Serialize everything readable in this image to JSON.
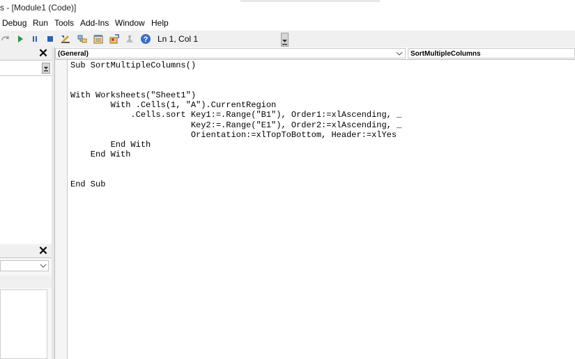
{
  "window": {
    "title": "s - [Module1 (Code)]"
  },
  "menu": [
    "Debug",
    "Run",
    "Tools",
    "Add-Ins",
    "Window",
    "Help"
  ],
  "toolbar": {
    "icons": [
      "redo-icon",
      "run-icon",
      "break-icon",
      "reset-icon",
      "design-mode-icon",
      "project-explorer-icon",
      "properties-window-icon",
      "object-browser-icon",
      "toolbox-icon",
      "help-icon"
    ],
    "position": "Ln 1, Col 1"
  },
  "code_window": {
    "object_combo": "(General)",
    "procedure_combo": "SortMultipleColumns",
    "lines": [
      "Sub SortMultipleColumns()",
      "",
      "",
      "With Worksheets(\"Sheet1\")",
      "        With .Cells(1, \"A\").CurrentRegion",
      "            .Cells.sort Key1:=.Range(\"B1\"), Order1:=xlAscending, _",
      "                        Key2:=.Range(\"E1\"), Order2:=xlAscending, _",
      "                        Orientation:=xlTopToBottom, Header:=xlYes",
      "        End With",
      "    End With",
      "",
      "",
      "End Sub"
    ]
  },
  "colors": {
    "toolbar_bg": "#f0f0f0",
    "keyword": "#00008b",
    "help_icon": "#3a6fc4"
  }
}
